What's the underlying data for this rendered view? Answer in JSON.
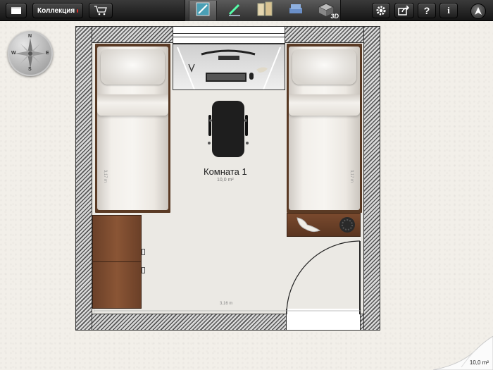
{
  "toolbar": {
    "collection_label": "Коллекция",
    "icons": {
      "menu": "folder-icon",
      "cart": "cart-icon",
      "settings": "gear-icon",
      "share": "share-icon",
      "help": "help-icon",
      "info": "info-icon",
      "navigate": "navigation-arrow-icon"
    },
    "modes": [
      {
        "name": "room-mode",
        "active": true
      },
      {
        "name": "wall-draw-mode",
        "active": false
      },
      {
        "name": "doors-windows-mode",
        "active": false
      },
      {
        "name": "furniture-mode",
        "active": false
      },
      {
        "name": "3d-view-mode",
        "active": false,
        "label": "3D"
      }
    ],
    "help_label": "?",
    "info_label": "i"
  },
  "compass": {
    "north": "N",
    "south": "S",
    "east": "E",
    "west": "W"
  },
  "plan": {
    "room_name": "Комната 1",
    "room_area": "10,0 m²",
    "bottom_dimension": "3,16 m",
    "left_bed_dimension": "3,17 m",
    "right_bed_dimension": "3,17 m"
  },
  "status": {
    "total_area": "10,0 m²"
  },
  "colors": {
    "toolbar_dark": "#151515",
    "wood": "#5a3a24",
    "floor": "#ebe9e4",
    "background": "#f2efe9"
  }
}
